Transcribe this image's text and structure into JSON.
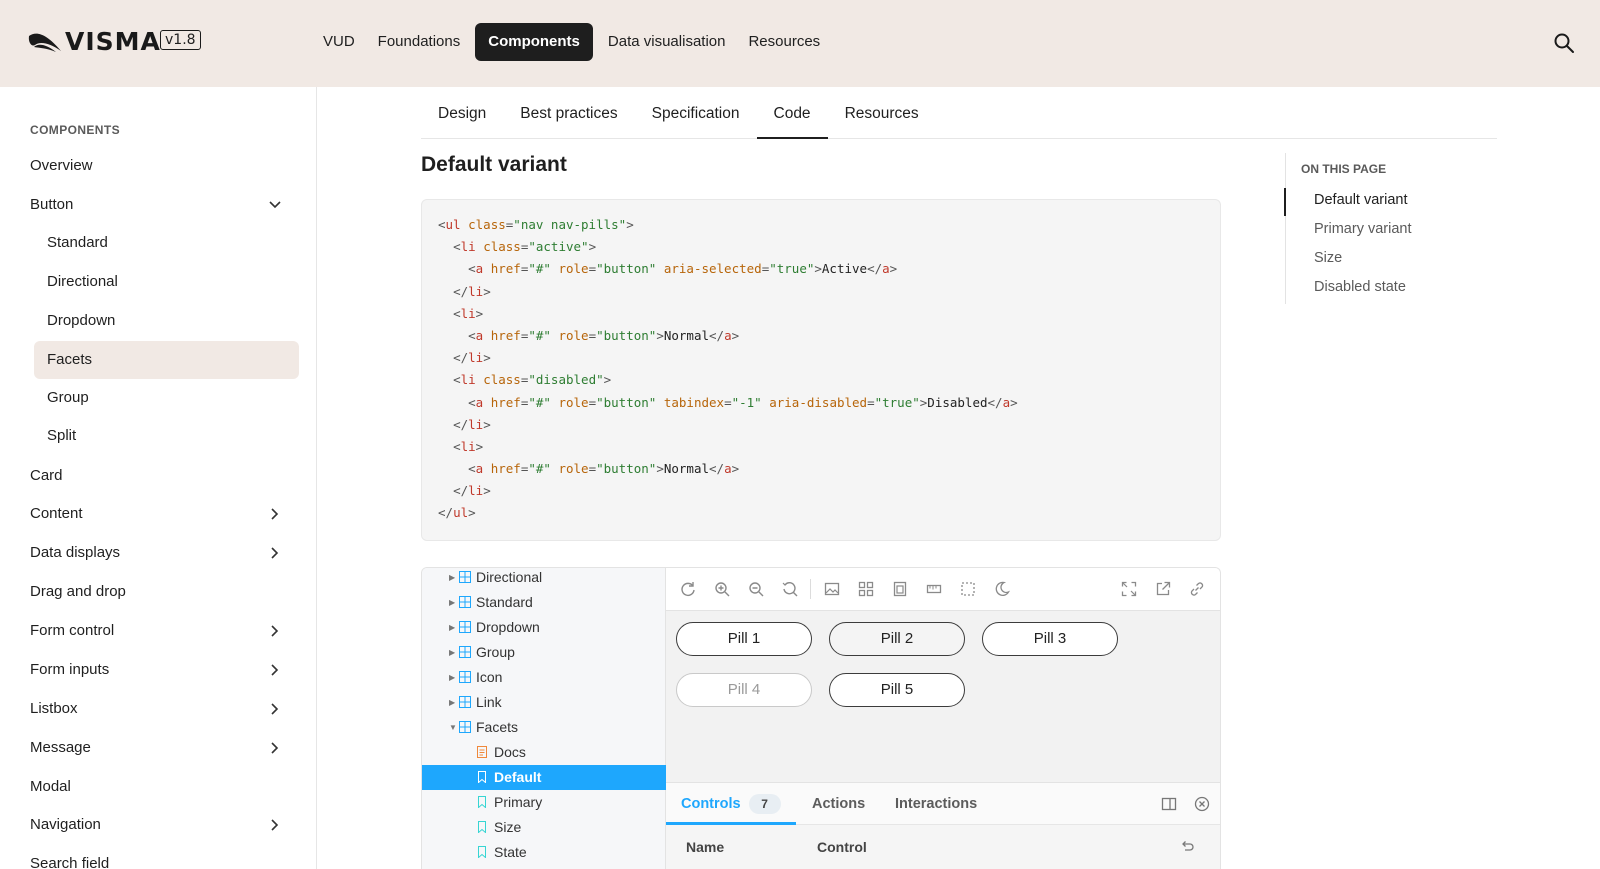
{
  "header": {
    "brand": "VISMA",
    "version": "v1.8",
    "nav": [
      "VUD",
      "Foundations",
      "Components",
      "Data visualisation",
      "Resources"
    ],
    "active_nav": "Components"
  },
  "sidebar": {
    "heading": "COMPONENTS",
    "items": [
      {
        "label": "Overview"
      },
      {
        "label": "Button"
      },
      {
        "label": "Standard"
      },
      {
        "label": "Directional"
      },
      {
        "label": "Dropdown"
      },
      {
        "label": "Facets"
      },
      {
        "label": "Group"
      },
      {
        "label": "Split"
      },
      {
        "label": "Card"
      },
      {
        "label": "Content"
      },
      {
        "label": "Data displays"
      },
      {
        "label": "Drag and drop"
      },
      {
        "label": "Form control"
      },
      {
        "label": "Form inputs"
      },
      {
        "label": "Listbox"
      },
      {
        "label": "Message"
      },
      {
        "label": "Modal"
      },
      {
        "label": "Navigation"
      },
      {
        "label": "Search field"
      }
    ]
  },
  "tabs": [
    "Design",
    "Best practices",
    "Specification",
    "Code",
    "Resources"
  ],
  "active_tab": "Code",
  "section_title": "Default variant",
  "code": {
    "tag_color": "#c0392b",
    "attr_color": "#b7650a",
    "string_color": "#2e7d32"
  },
  "toc": {
    "heading": "ON THIS PAGE",
    "items": [
      "Default variant",
      "Primary variant",
      "Size",
      "Disabled state"
    ],
    "current": "Default variant"
  },
  "storybook": {
    "tree": [
      {
        "label": "Directional"
      },
      {
        "label": "Standard"
      },
      {
        "label": "Dropdown"
      },
      {
        "label": "Group"
      },
      {
        "label": "Icon"
      },
      {
        "label": "Link"
      },
      {
        "label": "Facets"
      },
      {
        "label": "Docs"
      },
      {
        "label": "Default"
      },
      {
        "label": "Primary"
      },
      {
        "label": "Size"
      },
      {
        "label": "State"
      }
    ],
    "selected_story": "Default",
    "accent": "#1ea7fd",
    "pills": [
      "Pill 1",
      "Pill 2",
      "Pill 3",
      "Pill 4",
      "Pill 5"
    ],
    "addons": {
      "tabs": [
        "Controls",
        "Actions",
        "Interactions"
      ],
      "controls_count": "7",
      "columns": [
        "Name",
        "Control"
      ]
    }
  }
}
